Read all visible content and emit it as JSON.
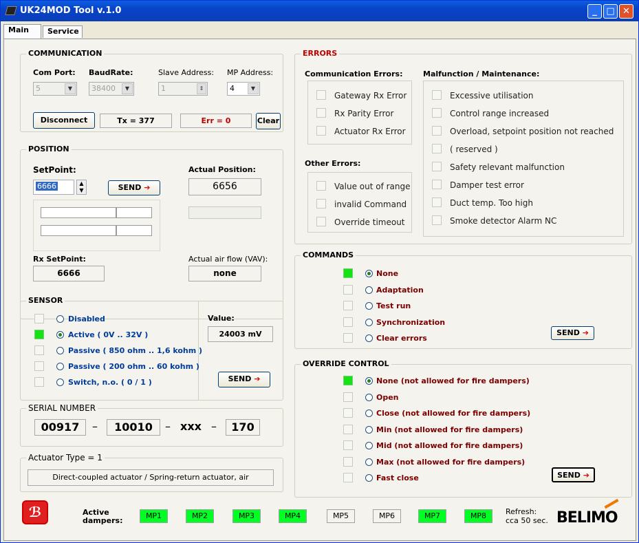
{
  "window": {
    "title": "UK24MOD Tool v.1.0"
  },
  "tabs": [
    "Main",
    "Service"
  ],
  "communication": {
    "title": "COMMUNICATION",
    "com_port_label": "Com Port:",
    "com_port_value": "5",
    "baud_label": "BaudRate:",
    "baud_value": "38400",
    "slave_label": "Slave Address:",
    "slave_value": "1",
    "mp_label": "MP Address:",
    "mp_value": "4",
    "disconnect": "Disconnect",
    "tx": "Tx = 377",
    "err": "Err = 0",
    "clear": "Clear"
  },
  "position": {
    "title": "POSITION",
    "setpoint_label": "SetPoint:",
    "setpoint_value": "6666",
    "send": "SEND",
    "actual_label": "Actual Position:",
    "actual_value": "6656",
    "rx_label": "Rx SetPoint:",
    "rx_value": "6666",
    "airflow_label": "Actual air flow (VAV):",
    "airflow_value": "none"
  },
  "sensor": {
    "title": "SENSOR",
    "options": [
      {
        "label": "Disabled",
        "checked": false,
        "lit": false
      },
      {
        "label": "Active ( 0V .. 32V )",
        "checked": true,
        "lit": true
      },
      {
        "label": "Passive ( 850 ohm .. 1,6 kohm )",
        "checked": false,
        "lit": false
      },
      {
        "label": "Passive ( 200 ohm .. 60 kohm )",
        "checked": false,
        "lit": false
      },
      {
        "label": "Switch, n.o. ( 0 / 1 )",
        "checked": false,
        "lit": false
      }
    ],
    "value_label": "Value:",
    "value": "24003 mV",
    "send": "SEND"
  },
  "serial": {
    "title": "SERIAL NUMBER",
    "p1": "00917",
    "d1": "–",
    "p2": "10010",
    "d2": "–",
    "p3": "xxx",
    "d3": "–",
    "p4": "170"
  },
  "actuator": {
    "title": "Actuator Type = 1",
    "desc": "Direct-coupled actuator / Spring-return actuator, air"
  },
  "errors": {
    "title": "ERRORS",
    "comm_label": "Communication Errors:",
    "comm": [
      "Gateway Rx Error",
      "Rx Parity Error",
      "Actuator Rx Error"
    ],
    "other_label": "Other Errors:",
    "other": [
      "Value out of range",
      "invalid Command",
      "Override timeout"
    ],
    "malf_label": "Malfunction / Maintenance:",
    "malf": [
      "Excessive utilisation",
      "Control range increased",
      "Overload, setpoint position not reached",
      "( reserved )",
      "Safety relevant malfunction",
      "Damper test error",
      "Duct temp. Too high",
      "Smoke detector Alarm NC"
    ]
  },
  "commands": {
    "title": "COMMANDS",
    "options": [
      {
        "label": "None",
        "checked": true
      },
      {
        "label": "Adaptation",
        "checked": false
      },
      {
        "label": "Test run",
        "checked": false
      },
      {
        "label": "Synchronization",
        "checked": false
      },
      {
        "label": "Clear errors",
        "checked": false
      }
    ],
    "send": "SEND"
  },
  "override": {
    "title": "OVERRIDE CONTROL",
    "options": [
      {
        "label": "None (not allowed for fire dampers)",
        "checked": true
      },
      {
        "label": "Open",
        "checked": false
      },
      {
        "label": "Close (not allowed for fire dampers)",
        "checked": false
      },
      {
        "label": "Min (not allowed for fire dampers)",
        "checked": false
      },
      {
        "label": "Mid (not allowed for fire dampers)",
        "checked": false
      },
      {
        "label": "Max (not allowed for fire dampers)",
        "checked": false
      },
      {
        "label": "Fast close",
        "checked": false
      }
    ],
    "send": "SEND"
  },
  "footer": {
    "active_label": "Active dampers:",
    "dampers": [
      {
        "label": "MP1",
        "on": true
      },
      {
        "label": "MP2",
        "on": true
      },
      {
        "label": "MP3",
        "on": true
      },
      {
        "label": "MP4",
        "on": true
      },
      {
        "label": "MP5",
        "on": false
      },
      {
        "label": "MP6",
        "on": false
      },
      {
        "label": "MP7",
        "on": true
      },
      {
        "label": "MP8",
        "on": true
      }
    ],
    "refresh_label": "Refresh:",
    "refresh_value": "cca 50 sec.",
    "brand": "BELIMO"
  },
  "colors": {
    "led_on": "#00ff22",
    "error_title": "#c00000",
    "sensor_text": "#003d9b",
    "command_text": "#7a0000"
  }
}
